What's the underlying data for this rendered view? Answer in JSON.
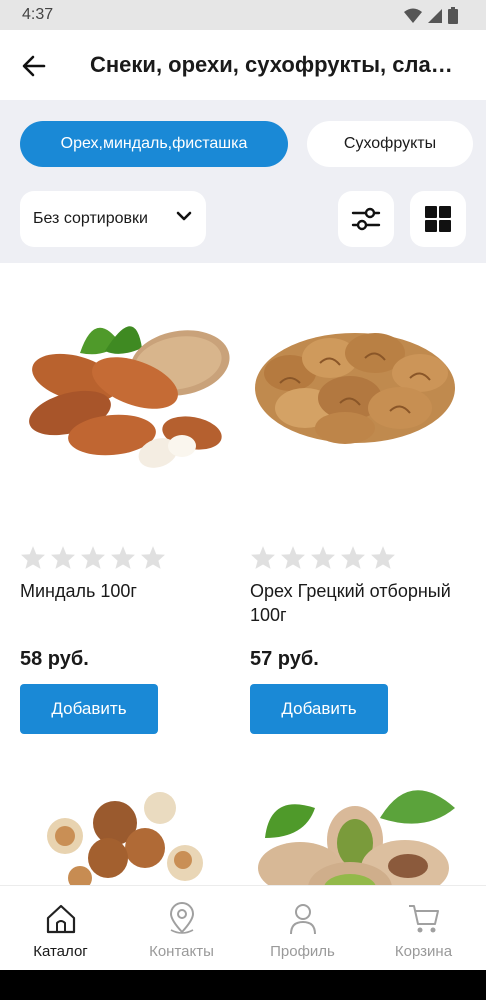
{
  "status_bar": {
    "time": "4:37"
  },
  "app_bar": {
    "title": "Снеки, орехи, сухофрукты, сладости"
  },
  "filters": {
    "chips": [
      {
        "label": "Орех,миндаль,фисташка",
        "active": true
      },
      {
        "label": "Сухофрукты",
        "active": false
      }
    ],
    "sort_label": "Без сортировки"
  },
  "products": [
    {
      "name": "Миндаль 100г",
      "price": "58 руб.",
      "add_label": "Добавить",
      "rating": 0
    },
    {
      "name": "Орех Грецкий отборный 100г",
      "price": "57 руб.",
      "add_label": "Добавить",
      "rating": 0
    },
    {
      "name": "",
      "price": "",
      "add_label": "",
      "rating": 0
    },
    {
      "name": "",
      "price": "",
      "add_label": "",
      "rating": 0
    }
  ],
  "bottom_nav": {
    "items": [
      {
        "label": "Каталог",
        "icon": "home-icon",
        "active": true
      },
      {
        "label": "Контакты",
        "icon": "location-pin-icon",
        "active": false
      },
      {
        "label": "Профиль",
        "icon": "person-icon",
        "active": false
      },
      {
        "label": "Корзина",
        "icon": "cart-icon",
        "active": false
      }
    ]
  },
  "colors": {
    "accent": "#1a89d6",
    "filter_background": "#eeeff4",
    "star_empty": "#e0e0e0"
  }
}
